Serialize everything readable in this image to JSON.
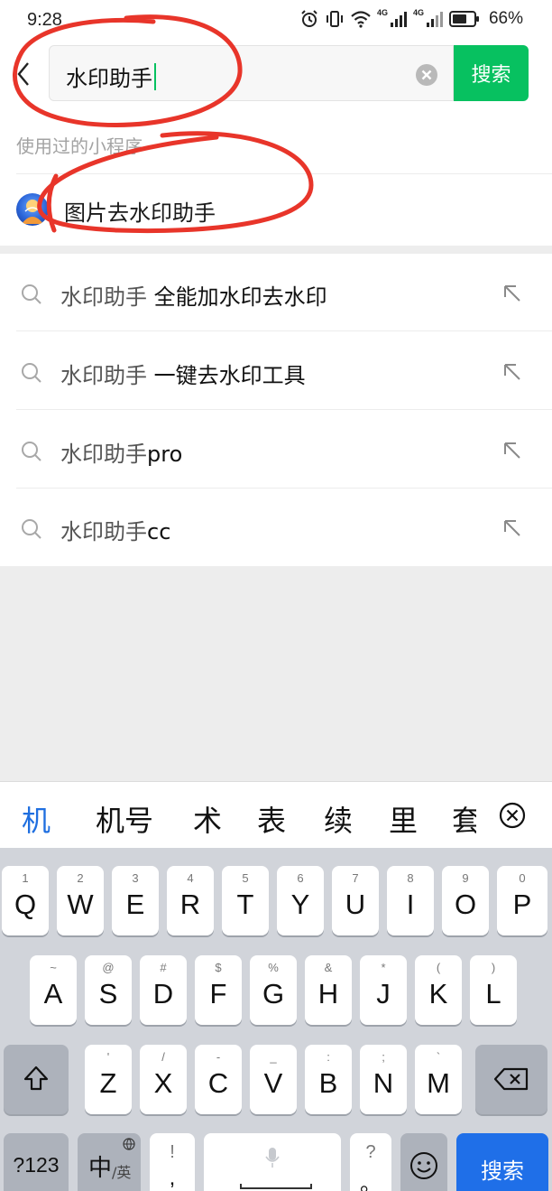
{
  "status_bar": {
    "time": "9:28",
    "net_tag_1": "4G",
    "net_tag_2": "4G",
    "battery": "66%"
  },
  "search": {
    "query": "水印助手",
    "submit_label": "搜索"
  },
  "used_section": {
    "title": "使用过的小程序",
    "items": [
      {
        "name": "图片去水印助手",
        "icon": "mini-program-logo"
      }
    ]
  },
  "suggestions": [
    {
      "keyword": "水印助手",
      "rest": " 全能加水印去水印"
    },
    {
      "keyword": "水印助手",
      "rest": " 一键去水印工具"
    },
    {
      "keyword": "水印助手",
      "rest": "pro"
    },
    {
      "keyword": "水印助手",
      "rest": "cc"
    }
  ],
  "candidates": [
    "机",
    "机号",
    "术",
    "表",
    "续",
    "里",
    "套"
  ],
  "keyboard": {
    "row1": [
      {
        "hint": "1",
        "key": "Q"
      },
      {
        "hint": "2",
        "key": "W"
      },
      {
        "hint": "3",
        "key": "E"
      },
      {
        "hint": "4",
        "key": "R"
      },
      {
        "hint": "5",
        "key": "T"
      },
      {
        "hint": "6",
        "key": "Y"
      },
      {
        "hint": "7",
        "key": "U"
      },
      {
        "hint": "8",
        "key": "I"
      },
      {
        "hint": "9",
        "key": "O"
      },
      {
        "hint": "0",
        "key": "P"
      }
    ],
    "row2": [
      {
        "hint": "~",
        "key": "A"
      },
      {
        "hint": "@",
        "key": "S"
      },
      {
        "hint": "#",
        "key": "D"
      },
      {
        "hint": "$",
        "key": "F"
      },
      {
        "hint": "%",
        "key": "G"
      },
      {
        "hint": "&",
        "key": "H"
      },
      {
        "hint": "*",
        "key": "J"
      },
      {
        "hint": "(",
        "key": "K"
      },
      {
        "hint": ")",
        "key": "L"
      }
    ],
    "row3": [
      {
        "hint": "'",
        "key": "Z"
      },
      {
        "hint": "/",
        "key": "X"
      },
      {
        "hint": "-",
        "key": "C"
      },
      {
        "hint": "_",
        "key": "V"
      },
      {
        "hint": ":",
        "key": "B"
      },
      {
        "hint": ";",
        "key": "N"
      },
      {
        "hint": "`",
        "key": "M"
      }
    ],
    "num_label": "?123",
    "lang_big": "中",
    "lang_small": "/英",
    "punct_top": "!",
    "punct_bottom": ",",
    "punct2_top": "?",
    "punct2_bottom": "。",
    "search_label": "搜索"
  },
  "colors": {
    "accent_green": "#07c160",
    "annotation_red": "#e8352a",
    "key_blue": "#1f6fe8"
  }
}
